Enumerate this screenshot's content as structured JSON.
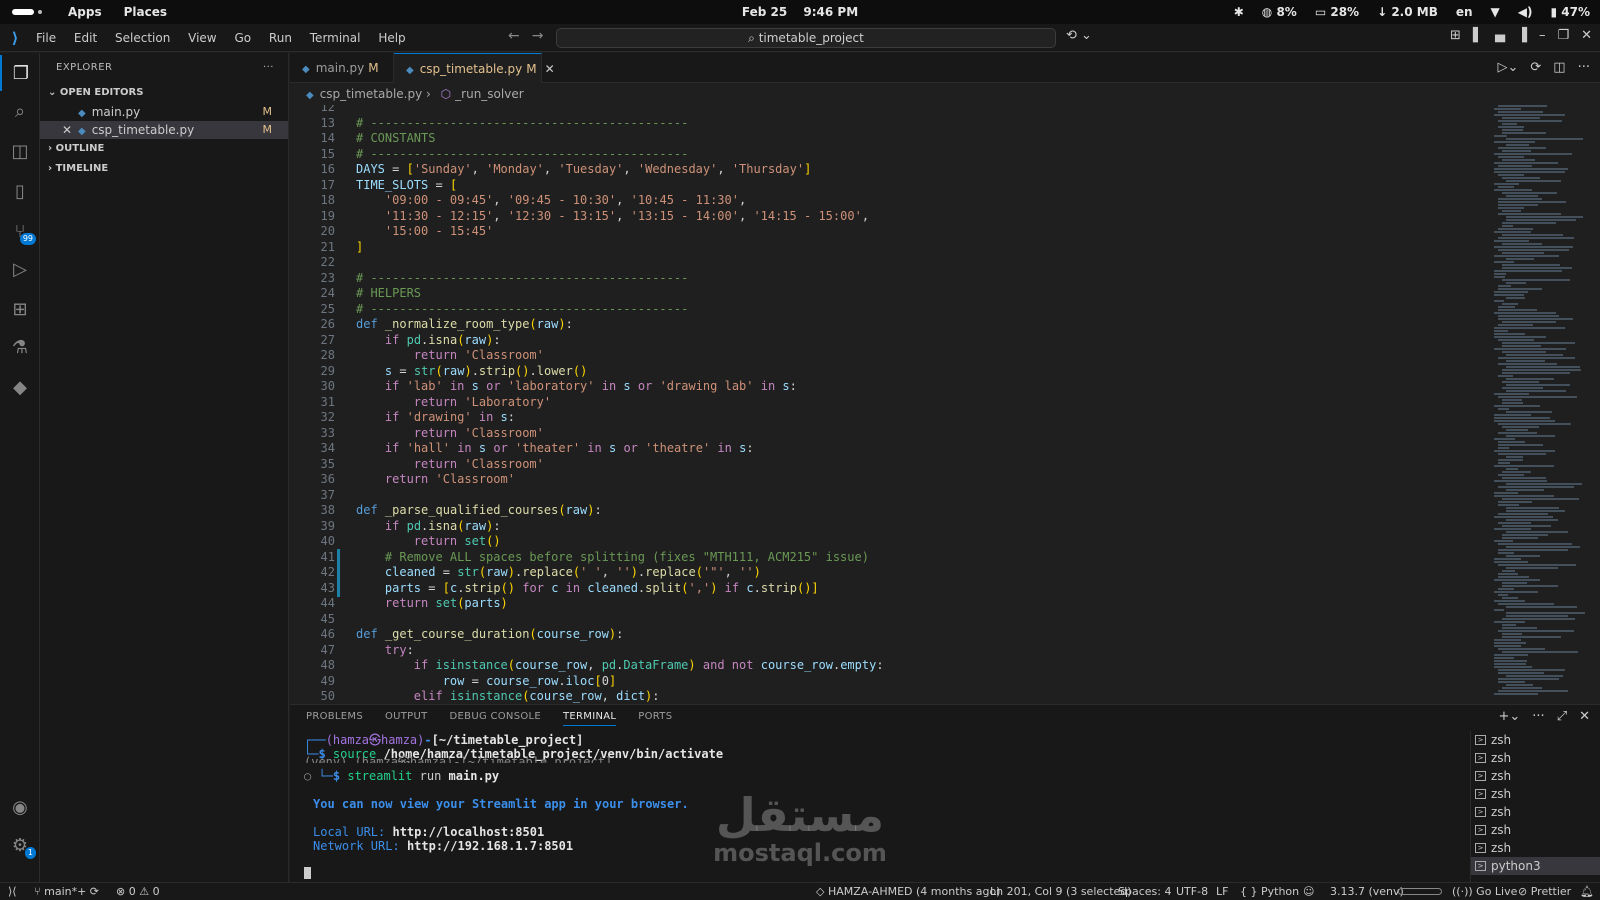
{
  "os": {
    "menus": [
      "Apps",
      "Places"
    ],
    "date": "Feb 25",
    "time": "9:46 PM",
    "tray": [
      "8%",
      "28%",
      "2.0 MB",
      "en",
      "47%"
    ]
  },
  "menubar": [
    "File",
    "Edit",
    "Selection",
    "View",
    "Go",
    "Run",
    "Terminal",
    "Help"
  ],
  "search": {
    "value": "timetable_project"
  },
  "sidebar": {
    "title": "EXPLORER",
    "more": "···",
    "open_editors": "OPEN EDITORS",
    "files": [
      {
        "name": "main.py",
        "status": "M"
      },
      {
        "name": "csp_timetable.py",
        "status": "M"
      }
    ],
    "outline": "OUTLINE",
    "timeline": "TIMELINE"
  },
  "activity": {
    "scm_badge": "99",
    "settings_badge": "1"
  },
  "tabs": [
    {
      "name": "main.py",
      "status": "M"
    },
    {
      "name": "csp_timetable.py",
      "status": "M"
    }
  ],
  "breadcrumbs": {
    "file": "csp_timetable.py",
    "symbol": "_run_solver"
  },
  "code": {
    "first_line": 12,
    "lines": [
      "",
      "# --------------------------------------------",
      "# CONSTANTS",
      "# --------------------------------------------",
      "DAYS = ['Sunday', 'Monday', 'Tuesday', 'Wednesday', 'Thursday']",
      "TIME_SLOTS = [",
      "    '09:00 - 09:45', '09:45 - 10:30', '10:45 - 11:30',",
      "    '11:30 - 12:15', '12:30 - 13:15', '13:15 - 14:00', '14:15 - 15:00',",
      "    '15:00 - 15:45'",
      "]",
      "",
      "# --------------------------------------------",
      "# HELPERS",
      "# --------------------------------------------",
      "def _normalize_room_type(raw):",
      "    if pd.isna(raw):",
      "        return 'Classroom'",
      "    s = str(raw).strip().lower()",
      "    if 'lab' in s or 'laboratory' in s or 'drawing lab' in s:",
      "        return 'Laboratory'",
      "    if 'drawing' in s:",
      "        return 'Classroom'",
      "    if 'hall' in s or 'theater' in s or 'theatre' in s:",
      "        return 'Classroom'",
      "    return 'Classroom'",
      "",
      "def _parse_qualified_courses(raw):",
      "    if pd.isna(raw):",
      "        return set()",
      "    # Remove ALL spaces before splitting (fixes \"MTH111, ACM215\" issue)",
      "    cleaned = str(raw).replace(' ', '').replace('\"', '')",
      "    parts = [c.strip() for c in cleaned.split(',') if c.strip()]",
      "    return set(parts)",
      "",
      "def _get_course_duration(course_row):",
      "    try:",
      "        if isinstance(course_row, pd.DataFrame) and not course_row.empty:",
      "            row = course_row.iloc[0]",
      "        elif isinstance(course_row, dict):"
    ]
  },
  "panel": {
    "tabs": [
      "PROBLEMS",
      "OUTPUT",
      "DEBUG CONSOLE",
      "TERMINAL",
      "PORTS"
    ],
    "active_tab": "TERMINAL",
    "terminal": {
      "prompt_user": "(hamza㉿hamza)",
      "prompt_dir": "[~/timetable_project]",
      "cmd1_word": "source",
      "cmd1_arg": "/home/hamza/timetable_project/venv/bin/activate",
      "overlap": "(venv) (hamza㉿hamza)-[~/timetable_project]",
      "cmd2_word": "streamlit",
      "cmd2_rest": "run",
      "cmd2_arg": "main.py",
      "info": "You can now view your Streamlit app in your browser.",
      "local_label": "Local URL:",
      "local_url": "http://localhost:8501",
      "network_label": "Network URL:",
      "network_url": "http://192.168.1.7:8501"
    },
    "terminals": [
      "zsh",
      "zsh",
      "zsh",
      "zsh",
      "zsh",
      "zsh",
      "zsh",
      "python3"
    ]
  },
  "watermark": {
    "arabic": "مستقل",
    "latin": "mostaql.com"
  },
  "status": {
    "branch": "main*+",
    "errors": "0",
    "warnings": "0",
    "blame": "HAMZA-AHMED (4 months ago)",
    "position": "Ln 201, Col 9 (3 selected)",
    "spaces": "Spaces: 4",
    "encoding": "UTF-8",
    "eol": "LF",
    "language": "Python",
    "interpreter": "3.13.7 (venv)",
    "golive": "Go Live",
    "prettier": "Prettier"
  }
}
